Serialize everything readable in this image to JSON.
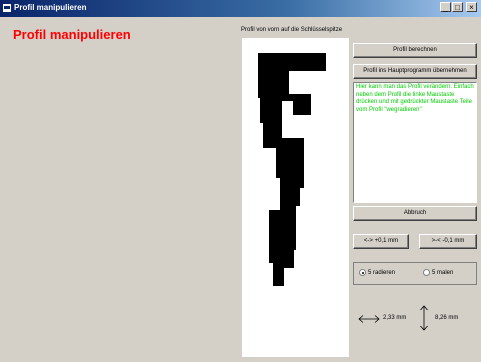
{
  "window": {
    "title": "Profil manipulieren",
    "minimize": "_",
    "maximize": "□",
    "close": "×"
  },
  "heading": "Profil manipulieren",
  "profile_label": "Profil von vorn auf die Schlüsselspitze",
  "buttons": {
    "compute": "Profil berechnen",
    "apply": "Profil ins Hauptprogramm übernehmen",
    "cancel": "Abbruch",
    "increase": "<-> +0,1 mm",
    "decrease": ">-< -0,1 mm"
  },
  "info_text": "Hier kann man das Profil verändern. Einfach neben dem Profil die linke Maustaste drücken und mit gedrückter Maustaste Teile vom Profil \"wegradieren\"",
  "radios": {
    "erase": "5 radieren",
    "paint": "5 malen",
    "selected": "erase"
  },
  "dimensions": {
    "width": "2,33 mm",
    "height": "8,26 mm"
  },
  "colors": {
    "heading": "#ff0000",
    "info_text": "#00cc00",
    "profile_fill": "#000000"
  }
}
